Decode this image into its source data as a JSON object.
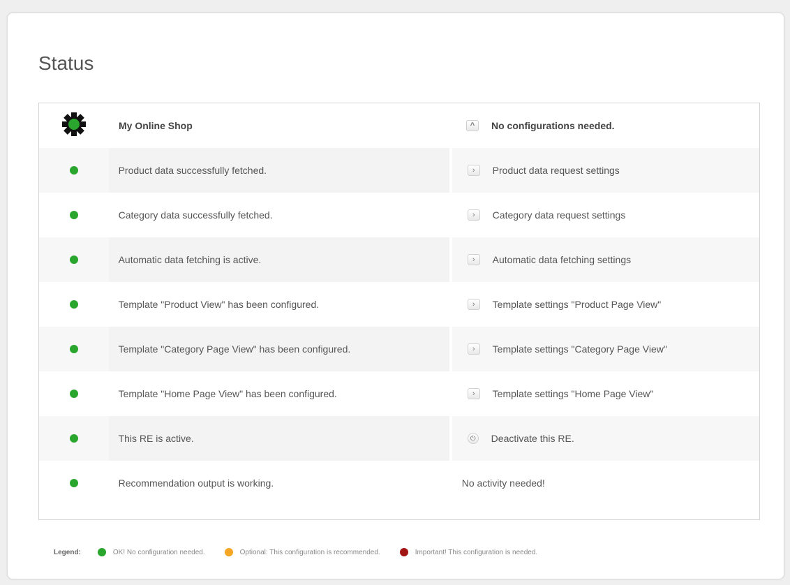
{
  "page": {
    "title": "Status"
  },
  "shop": {
    "name": "My Online Shop",
    "header_message": "No configurations needed.",
    "header_button_icon": "chevron-up-icon"
  },
  "rows": [
    {
      "status": "ok",
      "message": "Product data successfully fetched.",
      "action": "Product data request settings",
      "action_icon": "chevron-right-icon"
    },
    {
      "status": "ok",
      "message": "Category data successfully fetched.",
      "action": "Category data request settings",
      "action_icon": "chevron-right-icon"
    },
    {
      "status": "ok",
      "message": "Automatic data fetching is active.",
      "action": "Automatic data fetching settings",
      "action_icon": "chevron-right-icon"
    },
    {
      "status": "ok",
      "message": "Template \"Product View\" has been configured.",
      "action": "Template settings \"Product Page View\"",
      "action_icon": "chevron-right-icon"
    },
    {
      "status": "ok",
      "message": "Template \"Category Page View\" has been configured.",
      "action": "Template settings \"Category Page View\"",
      "action_icon": "chevron-right-icon"
    },
    {
      "status": "ok",
      "message": "Template \"Home Page View\" has been configured.",
      "action": "Template settings \"Home Page View\"",
      "action_icon": "chevron-right-icon"
    },
    {
      "status": "ok",
      "message": "This RE is active.",
      "action": "Deactivate this RE.",
      "action_icon": "power-icon"
    },
    {
      "status": "ok",
      "message": "Recommendation output is working.",
      "action": "No activity needed!",
      "action_icon": ""
    }
  ],
  "legend": {
    "label": "Legend:",
    "ok": "OK! No configuration needed.",
    "optional": "Optional: This configuration is recommended.",
    "important": "Important! This configuration is needed."
  },
  "colors": {
    "ok": "#2aa52e",
    "optional": "#f5a623",
    "important": "#a31515",
    "gear": "#2aa52e"
  }
}
